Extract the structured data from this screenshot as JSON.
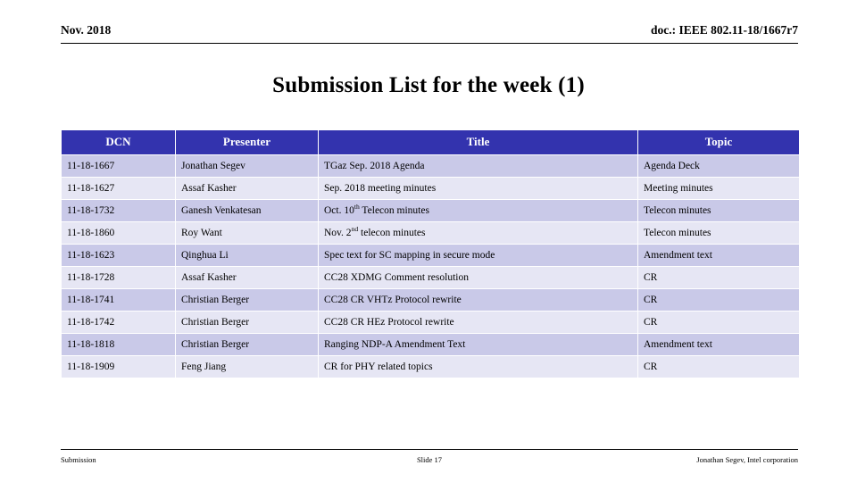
{
  "header": {
    "left": "Nov. 2018",
    "right": "doc.: IEEE 802.11-18/1667r7"
  },
  "title": "Submission List for the week (1)",
  "table": {
    "columns": [
      "DCN",
      "Presenter",
      "Title",
      "Topic"
    ],
    "header_bg": "#3333AE",
    "header_fg": "#FFFFFF",
    "row_dark_bg": "#C9C9E8",
    "row_light_bg": "#E6E6F4",
    "rows": [
      {
        "dcn": "11-18-1667",
        "presenter": "Jonathan Segev",
        "title": "TGaz Sep. 2018 Agenda",
        "title_pre": "TGaz Sep. 2018 Agenda",
        "title_sup": "",
        "title_post": "",
        "topic": "Agenda Deck"
      },
      {
        "dcn": "11-18-1627",
        "presenter": "Assaf Kasher",
        "title": "Sep. 2018 meeting minutes",
        "title_pre": "Sep. 2018 meeting minutes",
        "title_sup": "",
        "title_post": "",
        "topic": "Meeting minutes"
      },
      {
        "dcn": "11-18-1732",
        "presenter": "Ganesh Venkatesan",
        "title": "Oct. 10th Telecon minutes",
        "title_pre": "Oct. 10",
        "title_sup": "th",
        "title_post": " Telecon minutes",
        "topic": "Telecon minutes"
      },
      {
        "dcn": "11-18-1860",
        "presenter": "Roy Want",
        "title": "Nov. 2nd telecon minutes",
        "title_pre": "Nov. 2",
        "title_sup": "nd",
        "title_post": " telecon minutes",
        "topic": "Telecon minutes"
      },
      {
        "dcn": "11-18-1623",
        "presenter": "Qinghua Li",
        "title": "Spec text for SC mapping in secure mode",
        "title_pre": "Spec text for SC mapping in secure mode",
        "title_sup": "",
        "title_post": "",
        "topic": "Amendment text"
      },
      {
        "dcn": "11-18-1728",
        "presenter": "Assaf Kasher",
        "title": "CC28 XDMG Comment resolution",
        "title_pre": "CC28 XDMG Comment resolution",
        "title_sup": "",
        "title_post": "",
        "topic": "CR"
      },
      {
        "dcn": "11-18-1741",
        "presenter": "Christian Berger",
        "title": "CC28 CR VHTz Protocol rewrite",
        "title_pre": "CC28 CR VHTz Protocol rewrite",
        "title_sup": "",
        "title_post": "",
        "topic": "CR"
      },
      {
        "dcn": "11-18-1742",
        "presenter": "Christian Berger",
        "title": "CC28 CR HEz Protocol rewrite",
        "title_pre": "CC28 CR HEz Protocol rewrite",
        "title_sup": "",
        "title_post": "",
        "topic": "CR"
      },
      {
        "dcn": "11-18-1818",
        "presenter": "Christian Berger",
        "title": "Ranging NDP-A Amendment Text",
        "title_pre": "Ranging NDP-A Amendment Text",
        "title_sup": "",
        "title_post": "",
        "topic": "Amendment text"
      },
      {
        "dcn": "11-18-1909",
        "presenter": "Feng Jiang",
        "title": "CR for PHY related topics",
        "title_pre": "CR for PHY related topics",
        "title_sup": "",
        "title_post": "",
        "topic": "CR"
      }
    ]
  },
  "footer": {
    "left": "Submission",
    "center": "Slide 17",
    "right": "Jonathan Segev, Intel corporation"
  }
}
